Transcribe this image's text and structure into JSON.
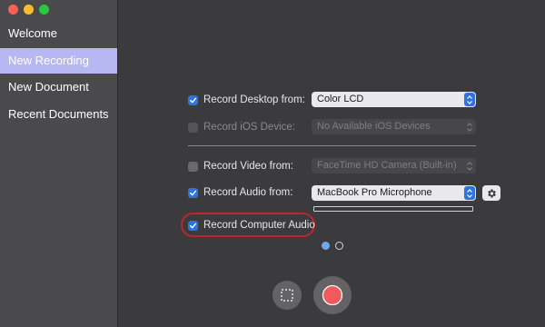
{
  "sidebar": {
    "items": [
      {
        "label": "Welcome",
        "selected": false
      },
      {
        "label": "New Recording",
        "selected": true
      },
      {
        "label": "New Document",
        "selected": false
      },
      {
        "label": "Recent Documents",
        "selected": false
      }
    ]
  },
  "options": {
    "record_desktop": {
      "label": "Record Desktop from:",
      "checked": true,
      "value": "Color LCD"
    },
    "record_ios": {
      "label": "Record iOS Device:",
      "checked": false,
      "enabled": false,
      "value": "No Available iOS Devices"
    },
    "record_video": {
      "label": "Record Video from:",
      "checked": false,
      "value": "FaceTime HD Camera (Built-in)"
    },
    "record_audio": {
      "label": "Record Audio from:",
      "checked": true,
      "value": "MacBook Pro Microphone"
    },
    "record_computer_audio": {
      "label": "Record Computer Audio",
      "checked": true
    }
  },
  "page_indicator": {
    "current": 1,
    "total": 2
  },
  "icons": {
    "checkmark": "checkmark-icon",
    "stepper": "chevron-up-down-icon",
    "gear": "gear-icon",
    "crop": "crop-region-icon",
    "record": "record-icon"
  },
  "colors": {
    "accent": "#2f73e0",
    "sidebar_selected": "#b7b8f3",
    "record_red": "#f05a5a",
    "highlight_ring": "#c0242e"
  }
}
